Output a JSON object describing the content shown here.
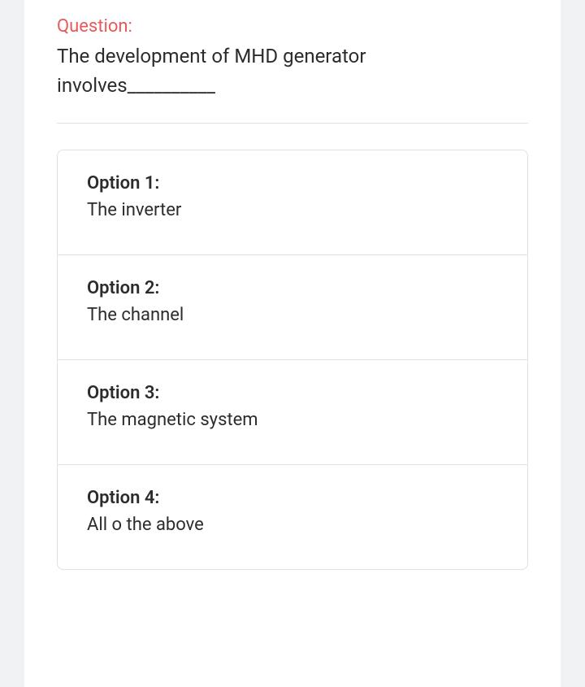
{
  "question": {
    "label": "Question:",
    "text": "The development of MHD generator involves__________"
  },
  "options": [
    {
      "label": "Option 1:",
      "text": "The inverter"
    },
    {
      "label": "Option 2:",
      "text": "The channel"
    },
    {
      "label": "Option 3:",
      "text": "The magnetic system"
    },
    {
      "label": "Option 4:",
      "text": "All o the above"
    }
  ]
}
